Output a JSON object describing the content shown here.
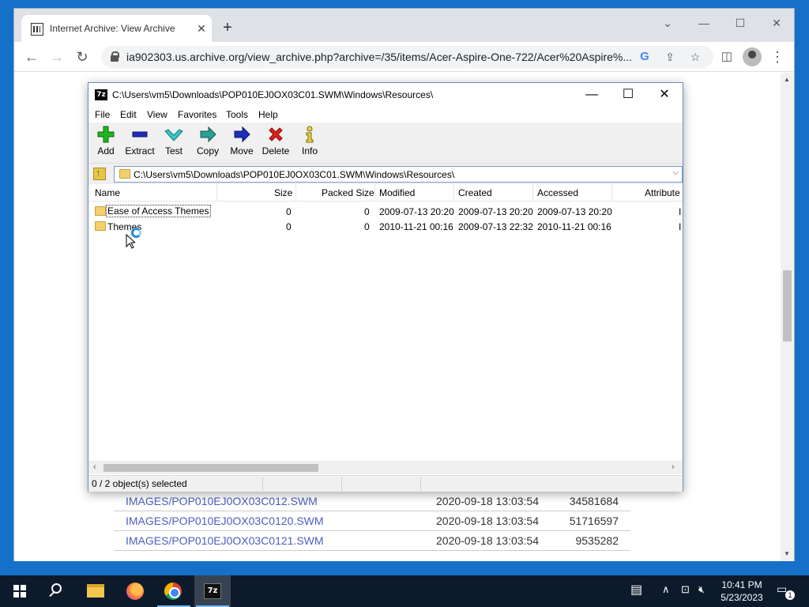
{
  "browser": {
    "tab_title": "Internet Archive: View Archive",
    "url": "ia902303.us.archive.org/view_archive.php?archive=/35/items/Acer-Aspire-One-722/Acer%20Aspire%..."
  },
  "page": {
    "rows": [
      {
        "name": "IMAGES/POP010EJ0OX03C012.SWM",
        "date": "2020-09-18 13:03:54",
        "size": "34581684"
      },
      {
        "name": "IMAGES/POP010EJ0OX03C0120.SWM",
        "date": "2020-09-18 13:03:54",
        "size": "51716597"
      },
      {
        "name": "IMAGES/POP010EJ0OX03C0121.SWM",
        "date": "2020-09-18 13:03:54",
        "size": "9535282"
      }
    ]
  },
  "sevenzip": {
    "title": "C:\\Users\\vm5\\Downloads\\POP010EJ0OX03C01.SWM\\Windows\\Resources\\",
    "menu": [
      "File",
      "Edit",
      "View",
      "Favorites",
      "Tools",
      "Help"
    ],
    "toolbar": {
      "add": "Add",
      "extract": "Extract",
      "test": "Test",
      "copy": "Copy",
      "move": "Move",
      "delete": "Delete",
      "info": "Info"
    },
    "address": "C:\\Users\\vm5\\Downloads\\POP010EJ0OX03C01.SWM\\Windows\\Resources\\",
    "columns": {
      "name": "Name",
      "size": "Size",
      "packed": "Packed Size",
      "modified": "Modified",
      "created": "Created",
      "accessed": "Accessed",
      "attributes": "Attribute"
    },
    "files": [
      {
        "name": "Ease of Access Themes",
        "size": "0",
        "packed": "0",
        "modified": "2009-07-13 20:20",
        "created": "2009-07-13 20:20",
        "accessed": "2009-07-13 20:20",
        "attr": "I"
      },
      {
        "name": "Themes",
        "size": "0",
        "packed": "0",
        "modified": "2010-11-21 00:16",
        "created": "2009-07-13 22:32",
        "accessed": "2010-11-21 00:16",
        "attr": "I"
      }
    ],
    "status": "0 / 2 object(s) selected"
  },
  "taskbar": {
    "time": "10:41 PM",
    "date": "5/23/2023",
    "notifications": "1",
    "sevenzip_label": "7z"
  },
  "colors": {
    "link": "#4a5fc1",
    "desktop": "#1570c9",
    "taskbar": "#0c1a2b"
  }
}
